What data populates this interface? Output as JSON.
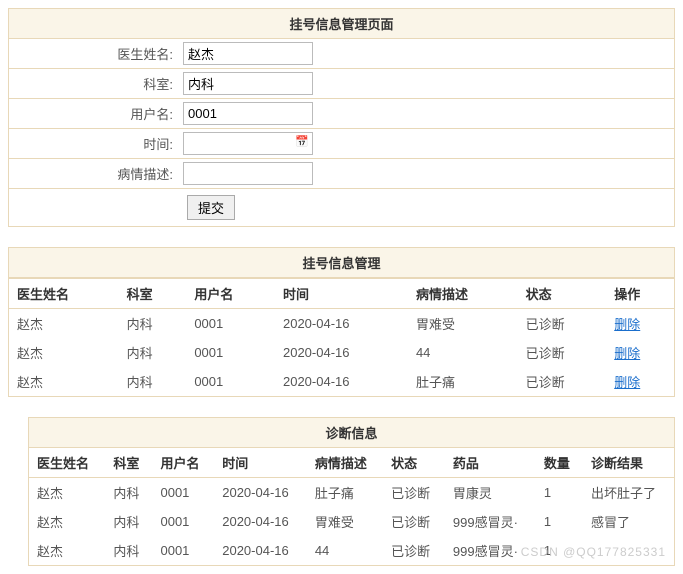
{
  "form": {
    "title": "挂号信息管理页面",
    "labels": {
      "doctor": "医生姓名:",
      "dept": "科室:",
      "user": "用户名:",
      "time": "时间:",
      "desc": "病情描述:"
    },
    "values": {
      "doctor": "赵杰",
      "dept": "内科",
      "user": "0001",
      "time": "",
      "desc": ""
    },
    "submit": "提交"
  },
  "list": {
    "title": "挂号信息管理",
    "headers": [
      "医生姓名",
      "科室",
      "用户名",
      "时间",
      "病情描述",
      "状态",
      "操作"
    ],
    "rows": [
      {
        "c": [
          "赵杰",
          "内科",
          "0001",
          "2020-04-16",
          "胃难受",
          "已诊断"
        ],
        "op": "删除"
      },
      {
        "c": [
          "赵杰",
          "内科",
          "0001",
          "2020-04-16",
          "44",
          "已诊断"
        ],
        "op": "删除"
      },
      {
        "c": [
          "赵杰",
          "内科",
          "0001",
          "2020-04-16",
          "肚子痛",
          "已诊断"
        ],
        "op": "删除"
      }
    ]
  },
  "diag": {
    "title": "诊断信息",
    "headers": [
      "医生姓名",
      "科室",
      "用户名",
      "时间",
      "病情描述",
      "状态",
      "药品",
      "数量",
      "诊断结果"
    ],
    "rows": [
      [
        "赵杰",
        "内科",
        "0001",
        "2020-04-16",
        "肚子痛",
        "已诊断",
        "胃康灵",
        "1",
        "出坏肚子了"
      ],
      [
        "赵杰",
        "内科",
        "0001",
        "2020-04-16",
        "胃难受",
        "已诊断",
        "999感冒灵·",
        "1",
        "感冒了"
      ],
      [
        "赵杰",
        "内科",
        "0001",
        "2020-04-16",
        "44",
        "已诊断",
        "999感冒灵·",
        "1",
        ""
      ]
    ]
  },
  "watermark": "CSDN @QQ177825331"
}
